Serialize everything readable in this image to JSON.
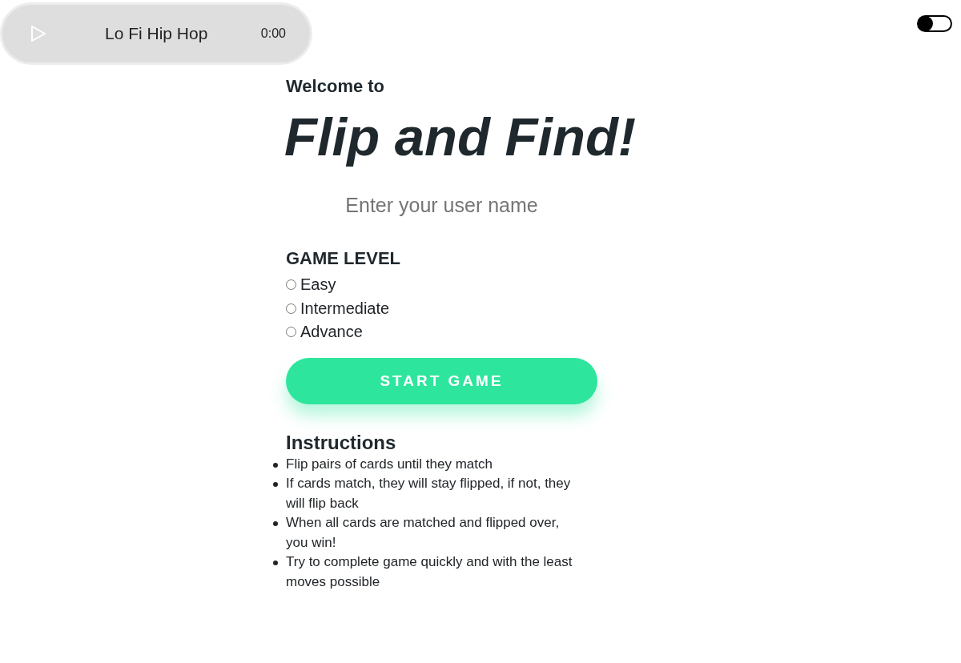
{
  "audio_player": {
    "playing": false,
    "track_title": "Lo Fi Hip Hop",
    "time": "0:00"
  },
  "theme_toggle": {
    "on": false
  },
  "welcome": "Welcome to",
  "title": "Flip and Find!",
  "username_field": {
    "placeholder": "Enter your user name"
  },
  "game_level": {
    "heading": "GAME LEVEL",
    "options": [
      {
        "label": "Easy",
        "selected": false
      },
      {
        "label": "Intermediate",
        "selected": false
      },
      {
        "label": "Advance",
        "selected": false
      }
    ]
  },
  "start_button": "START GAME",
  "instructions": {
    "heading": "Instructions",
    "items": [
      "Flip pairs of cards until they match",
      "If cards match, they will stay flipped, if not, they will flip back",
      "When all cards are matched and flipped over, you win!",
      "Try to complete game quickly and with the least moves possible"
    ]
  }
}
